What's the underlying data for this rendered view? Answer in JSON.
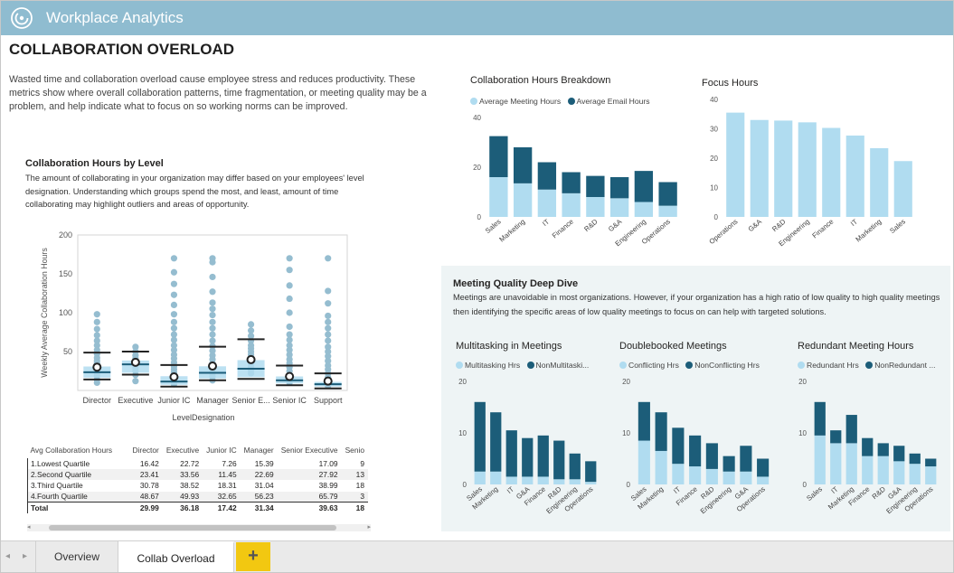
{
  "app": {
    "title": "Workplace Analytics"
  },
  "page": {
    "title": "COLLABORATION OVERLOAD",
    "intro": "Wasted time and collaboration overload cause employee stress and reduces productivity. These metrics show where overall collaboration patterns, time fragmentation, or meeting quality may be a problem, and help indicate what to focus on so working norms can be improved."
  },
  "level_section": {
    "title": "Collaboration Hours by Level",
    "description": "The amount of collaborating in your organization may differ based on your employees' level designation. Understanding which groups spend the most, and least, amount of time collaborating may highlight outliers and areas of opportunity."
  },
  "colors": {
    "light": "#b0dcf0",
    "dark": "#1c5d79",
    "boxplot_dot": "#95bdd0",
    "panel": "#eef4f5",
    "accent": "#f2c811"
  },
  "chart_data": [
    {
      "id": "collab_breakdown",
      "type": "bar",
      "stacked": true,
      "title": "Collaboration Hours Breakdown",
      "categories": [
        "Sales",
        "Marketing",
        "IT",
        "Finance",
        "R&D",
        "G&A",
        "Engineering",
        "Operations"
      ],
      "series": [
        {
          "name": "Average Meeting Hours",
          "color": "#b0dcf0",
          "values": [
            16,
            13.5,
            11,
            9.5,
            8,
            7.5,
            6,
            4.5
          ]
        },
        {
          "name": "Average Email Hours",
          "color": "#1c5d79",
          "values": [
            16.5,
            14.5,
            11,
            8.5,
            8.5,
            8.5,
            12.5,
            9.5
          ]
        }
      ],
      "ylim": [
        0,
        40
      ],
      "yticks": [
        0,
        20,
        40
      ],
      "grid": false,
      "legend": "top-left"
    },
    {
      "id": "focus_hours",
      "type": "bar",
      "title": "Focus Hours",
      "categories": [
        "Operations",
        "G&A",
        "R&D",
        "Engineering",
        "Finance",
        "IT",
        "Marketing",
        "Sales"
      ],
      "series": [
        {
          "color": "#b0dcf0",
          "values": [
            35.5,
            33,
            32.8,
            32.2,
            30.3,
            27.7,
            23.4,
            19
          ]
        }
      ],
      "ylim": [
        0,
        40
      ],
      "yticks": [
        0,
        10,
        20,
        30,
        40
      ],
      "grid": false
    },
    {
      "id": "collab_by_level",
      "type": "boxplot",
      "xlabel": "LevelDesignation",
      "ylabel": "Weekly Average Collaboration Hours",
      "ylim": [
        0,
        200
      ],
      "yticks": [
        50,
        100,
        150,
        200
      ],
      "categories": [
        "Director",
        "Executive",
        "Junior IC",
        "Manager",
        "Senior E...",
        "Senior IC",
        "Support"
      ],
      "groups": [
        {
          "q1": 16.42,
          "median": 23.41,
          "mean": 29.99,
          "q3": 30.78,
          "max": 48.67,
          "points": [
            98,
            88,
            79,
            71,
            64,
            58,
            52,
            47,
            42,
            38,
            35,
            31,
            27,
            23,
            19,
            14,
            10
          ]
        },
        {
          "q1": 22.72,
          "median": 33.56,
          "mean": 36.18,
          "q3": 38.52,
          "max": 49.93,
          "points": [
            56,
            50,
            45,
            41,
            37,
            33,
            29,
            25,
            20,
            12
          ]
        },
        {
          "q1": 7.26,
          "median": 11.45,
          "mean": 17.42,
          "q3": 18.31,
          "max": 32.65,
          "points": [
            170,
            152,
            137,
            123,
            110,
            98,
            88,
            80,
            72,
            65,
            58,
            52,
            46,
            41,
            36,
            31,
            27,
            23,
            19,
            15,
            11,
            8
          ]
        },
        {
          "q1": 15.39,
          "median": 22.69,
          "mean": 31.34,
          "q3": 31.04,
          "max": 56.23,
          "points": [
            170,
            165,
            146,
            127,
            113,
            105,
            97,
            88,
            80,
            72,
            64,
            57,
            51,
            45,
            40,
            35,
            30,
            26,
            22,
            18,
            13
          ]
        },
        {
          "q1": 17.09,
          "median": 27.92,
          "mean": 39.63,
          "q3": 38.99,
          "max": 65.79,
          "points": [
            85,
            77,
            70,
            64,
            58,
            54,
            50,
            46,
            42,
            38,
            34,
            30,
            26,
            22
          ]
        },
        {
          "q1": 9,
          "median": 13,
          "mean": 18,
          "q3": 18,
          "max": 32,
          "points": [
            170,
            155,
            135,
            118,
            100,
            82,
            72,
            65,
            58,
            52,
            46,
            40,
            35,
            30,
            25,
            20,
            15,
            10
          ]
        },
        {
          "q1": 5,
          "median": 8,
          "mean": 12,
          "q3": 11,
          "max": 22,
          "points": [
            170,
            128,
            112,
            96,
            88,
            80,
            72,
            64,
            56,
            50,
            44,
            38,
            32,
            27,
            22,
            17,
            13,
            9,
            6
          ]
        }
      ]
    },
    {
      "id": "collab_table",
      "type": "table",
      "columns": [
        "Avg Collaboration Hours",
        "Director",
        "Executive",
        "Junior IC",
        "Manager",
        "Senior Executive",
        "Senio"
      ],
      "rows": [
        [
          "1.Lowest Quartile",
          "16.42",
          "22.72",
          "7.26",
          "15.39",
          "17.09",
          "9"
        ],
        [
          "2.Second Quartile",
          "23.41",
          "33.56",
          "11.45",
          "22.69",
          "27.92",
          "13"
        ],
        [
          "3.Third Quartile",
          "30.78",
          "38.52",
          "18.31",
          "31.04",
          "38.99",
          "18"
        ],
        [
          "4.Fourth Quartile",
          "48.67",
          "49.93",
          "32.65",
          "56.23",
          "65.79",
          "3"
        ]
      ],
      "total": [
        "Total",
        "29.99",
        "36.18",
        "17.42",
        "31.34",
        "39.63",
        "18"
      ]
    },
    {
      "id": "multitasking",
      "type": "bar",
      "stacked": true,
      "title": "Multitasking in Meetings",
      "categories": [
        "Sales",
        "Marketing",
        "IT",
        "G&A",
        "Finance",
        "R&D",
        "Engineering",
        "Operations"
      ],
      "series": [
        {
          "name": "Multitasking Hrs",
          "color": "#b0dcf0",
          "values": [
            2.5,
            2.5,
            1.5,
            1.5,
            1.5,
            1,
            1,
            0.5
          ]
        },
        {
          "name": "NonMultitaski...",
          "color": "#1c5d79",
          "values": [
            13.5,
            11.5,
            9,
            7.5,
            8,
            7.5,
            5,
            4
          ]
        }
      ],
      "ylim": [
        0,
        20
      ],
      "yticks": [
        0,
        10,
        20
      ],
      "legend": "top-left"
    },
    {
      "id": "doublebooked",
      "type": "bar",
      "stacked": true,
      "title": "Doublebooked Meetings",
      "categories": [
        "Sales",
        "Marketing",
        "IT",
        "Finance",
        "R&D",
        "Engineering",
        "G&A",
        "Operations"
      ],
      "series": [
        {
          "name": "Conflicting Hrs",
          "color": "#b0dcf0",
          "values": [
            8.5,
            6.5,
            4,
            3.5,
            3,
            2.5,
            2.5,
            1.5
          ]
        },
        {
          "name": "NonConflicting Hrs",
          "color": "#1c5d79",
          "values": [
            7.5,
            7.5,
            7,
            6,
            5,
            3,
            5,
            3.5
          ]
        }
      ],
      "ylim": [
        0,
        20
      ],
      "yticks": [
        0,
        10,
        20
      ],
      "legend": "top-left"
    },
    {
      "id": "redundant",
      "type": "bar",
      "stacked": true,
      "title": "Redundant Meeting Hours",
      "categories": [
        "Sales",
        "IT",
        "Marketing",
        "Finance",
        "R&D",
        "G&A",
        "Engineering",
        "Operations"
      ],
      "series": [
        {
          "name": "Redundant Hrs",
          "color": "#b0dcf0",
          "values": [
            9.5,
            8,
            8,
            5.5,
            5.5,
            4.5,
            4,
            3.5
          ]
        },
        {
          "name": "NonRedundant ...",
          "color": "#1c5d79",
          "values": [
            6.5,
            2.5,
            5.5,
            3.5,
            2.5,
            3,
            2,
            1.5
          ]
        }
      ],
      "ylim": [
        0,
        20
      ],
      "yticks": [
        0,
        10,
        20
      ],
      "legend": "top-left"
    }
  ],
  "mq_section": {
    "title": "Meeting Quality Deep Dive",
    "description": "Meetings are unavoidable in most organizations. However, if your organization has a high ratio of low quality to high quality meetings then identifying the specific areas of low quality meetings to focus on can help with targeted solutions."
  },
  "scrollbar": {
    "left_arrow": "◂",
    "right_arrow": "▸"
  },
  "tabs": {
    "prev_nav": "◂",
    "next_nav": "▸",
    "overview": "Overview",
    "collab": "Collab Overload",
    "add": "+"
  }
}
